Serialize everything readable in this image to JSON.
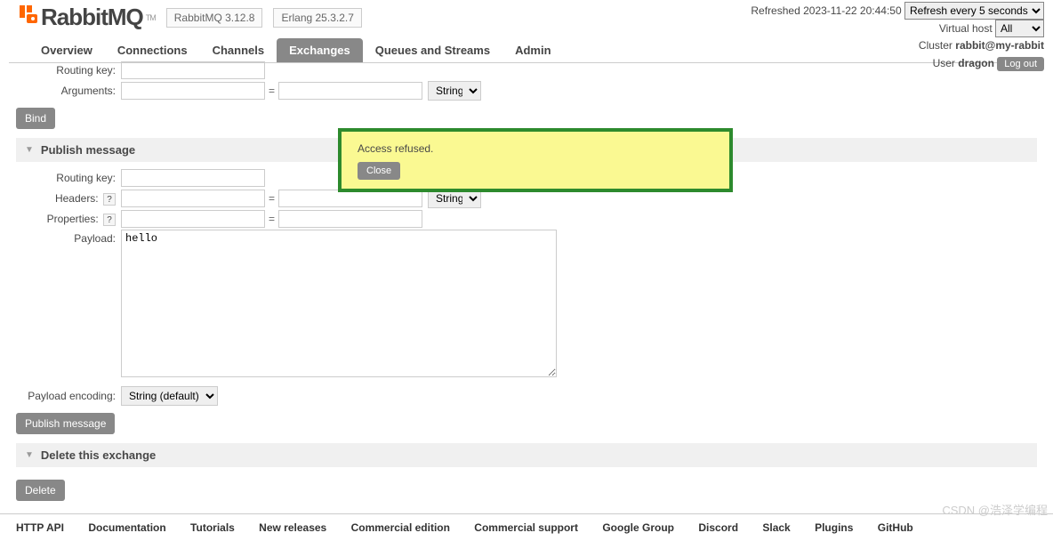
{
  "header": {
    "logo_text": "RabbitMQ",
    "tm": "TM",
    "version": "RabbitMQ 3.12.8",
    "erlang": "Erlang 25.3.2.7"
  },
  "topright": {
    "refreshed_label": "Refreshed",
    "refreshed_time": "2023-11-22 20:44:50",
    "refresh_select": "Refresh every 5 seconds",
    "vhost_label": "Virtual host",
    "vhost_value": "All",
    "cluster_label": "Cluster",
    "cluster_value": "rabbit@my-rabbit",
    "user_label": "User",
    "user_value": "dragon",
    "logout": "Log out"
  },
  "tabs": {
    "overview": "Overview",
    "connections": "Connections",
    "channels": "Channels",
    "exchanges": "Exchanges",
    "queues": "Queues and Streams",
    "admin": "Admin"
  },
  "binding": {
    "routing_key_label": "Routing key:",
    "arguments_label": "Arguments:",
    "type_select": "String",
    "bind_btn": "Bind"
  },
  "publish": {
    "section_title": "Publish message",
    "routing_key_label": "Routing key:",
    "headers_label": "Headers:",
    "headers_help": "?",
    "headers_type": "String",
    "properties_label": "Properties:",
    "properties_help": "?",
    "payload_label": "Payload:",
    "payload_value": "hello",
    "encoding_label": "Payload encoding:",
    "encoding_value": "String (default)",
    "publish_btn": "Publish message"
  },
  "delete": {
    "section_title": "Delete this exchange",
    "delete_btn": "Delete"
  },
  "alert": {
    "message": "Access refused.",
    "close": "Close"
  },
  "footer": {
    "links": [
      "HTTP API",
      "Documentation",
      "Tutorials",
      "New releases",
      "Commercial edition",
      "Commercial support",
      "Google Group",
      "Discord",
      "Slack",
      "Plugins",
      "GitHub"
    ]
  },
  "watermark": "CSDN @浩泽学编程"
}
